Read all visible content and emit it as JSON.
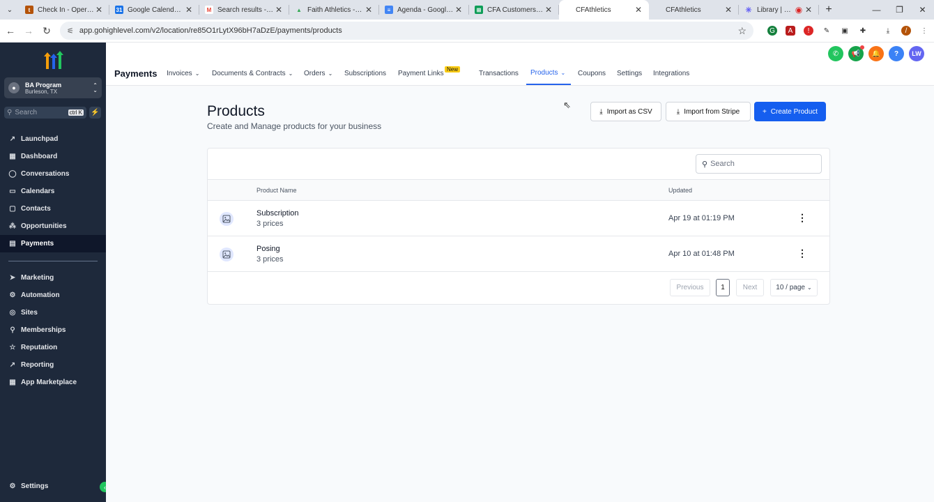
{
  "browser": {
    "tabs": [
      {
        "title": "Check In - Operations",
        "fav_color": "#b45309",
        "fav_glyph": "t"
      },
      {
        "title": "Google Calendar - W",
        "fav_color": "#1a73e8",
        "fav_glyph": "31"
      },
      {
        "title": "Search results - lucas",
        "fav_color": "#ea4335",
        "fav_glyph": "M"
      },
      {
        "title": "Faith Athletics - Goog",
        "fav_color": "#34a853",
        "fav_glyph": "▲"
      },
      {
        "title": "Agenda - Google Do",
        "fav_color": "#4285f4",
        "fav_glyph": "≡"
      },
      {
        "title": "CFA Customers - Hur",
        "fav_color": "#0f9d58",
        "fav_glyph": "⊞"
      },
      {
        "title": "CFAthletics",
        "fav_color": "",
        "fav_glyph": ""
      },
      {
        "title": "CFAthletics",
        "fav_color": "",
        "fav_glyph": ""
      },
      {
        "title": "Library | Loom",
        "fav_color": "#625df5",
        "fav_glyph": "✳"
      }
    ],
    "url": "app.gohighlevel.com/v2/location/re85O1rLytX96bH7aDzE/payments/products"
  },
  "sidebar": {
    "account_name": "BA Program",
    "account_location": "Burleson, TX",
    "search_label": "Search",
    "search_shortcut": "ctrl K",
    "items_top": [
      {
        "label": "Launchpad",
        "icon": "↗"
      },
      {
        "label": "Dashboard",
        "icon": "▦"
      },
      {
        "label": "Conversations",
        "icon": "◯"
      },
      {
        "label": "Calendars",
        "icon": "▭"
      },
      {
        "label": "Contacts",
        "icon": "▢"
      },
      {
        "label": "Opportunities",
        "icon": "⁂"
      },
      {
        "label": "Payments",
        "icon": "▤"
      }
    ],
    "items_bottom": [
      {
        "label": "Marketing",
        "icon": "➤"
      },
      {
        "label": "Automation",
        "icon": "⚙"
      },
      {
        "label": "Sites",
        "icon": "◎"
      },
      {
        "label": "Memberships",
        "icon": "⚲"
      },
      {
        "label": "Reputation",
        "icon": "☆"
      },
      {
        "label": "Reporting",
        "icon": "↗"
      },
      {
        "label": "App Marketplace",
        "icon": "▦"
      }
    ],
    "settings_label": "Settings"
  },
  "topnav": {
    "title": "Payments",
    "items": {
      "invoices": "Invoices",
      "documents": "Documents & Contracts",
      "orders": "Orders",
      "subscriptions": "Subscriptions",
      "payment_links": "Payment Links",
      "transactions": "Transactions",
      "products": "Products",
      "coupons": "Coupons",
      "settings": "Settings",
      "integrations": "Integrations"
    },
    "new_badge": "New",
    "avatar_initials": "LW"
  },
  "page": {
    "title": "Products",
    "subtitle": "Create and Manage products for your business",
    "import_csv": "Import as CSV",
    "import_stripe": "Import from Stripe",
    "create_product": "Create Product",
    "search_placeholder": "Search",
    "columns": {
      "name": "Product Name",
      "updated": "Updated"
    },
    "rows": [
      {
        "name": "Subscription",
        "prices": "3 prices",
        "updated": "Apr 19 at 01:19 PM"
      },
      {
        "name": "Posing",
        "prices": "3 prices",
        "updated": "Apr 10 at 01:48 PM"
      }
    ],
    "pagination": {
      "previous": "Previous",
      "current": "1",
      "next": "Next",
      "page_size": "10 / page"
    }
  }
}
